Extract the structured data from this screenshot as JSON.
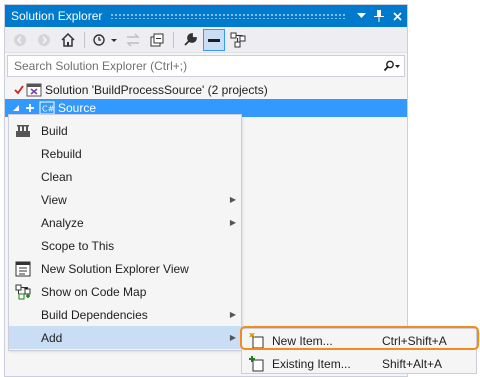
{
  "window": {
    "title": "Solution Explorer",
    "title_buttons": [
      {
        "icon": "dropdown-arrow-icon",
        "glyph": "▾"
      },
      {
        "icon": "pin-icon",
        "glyph": "⊥"
      },
      {
        "icon": "close-icon",
        "glyph": "✕"
      }
    ]
  },
  "search": {
    "placeholder": "Search Solution Explorer (Ctrl+;)"
  },
  "tree": {
    "solution_label": "Solution 'BuildProcessSource' (2 projects)",
    "project_label": "Source"
  },
  "context_menu": {
    "items": [
      {
        "label": "Build",
        "icon": "build-icon"
      },
      {
        "label": "Rebuild",
        "icon": ""
      },
      {
        "label": "Clean",
        "icon": ""
      },
      {
        "label": "View",
        "submenu": true
      },
      {
        "label": "Analyze",
        "submenu": true
      },
      {
        "label": "Scope to This",
        "icon": ""
      },
      {
        "label": "New Solution Explorer View",
        "icon": "new-view-icon"
      },
      {
        "label": "Show on Code Map",
        "icon": "code-map-icon"
      },
      {
        "label": "Build Dependencies",
        "submenu": true
      },
      {
        "label": "Add",
        "submenu": true,
        "highlighted": true
      }
    ]
  },
  "submenu": {
    "items": [
      {
        "label": "New Item...",
        "shortcut": "Ctrl+Shift+A",
        "icon": "new-item-icon"
      },
      {
        "label": "Existing Item...",
        "shortcut": "Shift+Alt+A",
        "icon": "existing-item-icon"
      }
    ]
  },
  "colors": {
    "accent": "#007acc",
    "selection": "#3399ff",
    "highlight_outline": "#f28a1e",
    "menu_hover": "#c9def5"
  }
}
